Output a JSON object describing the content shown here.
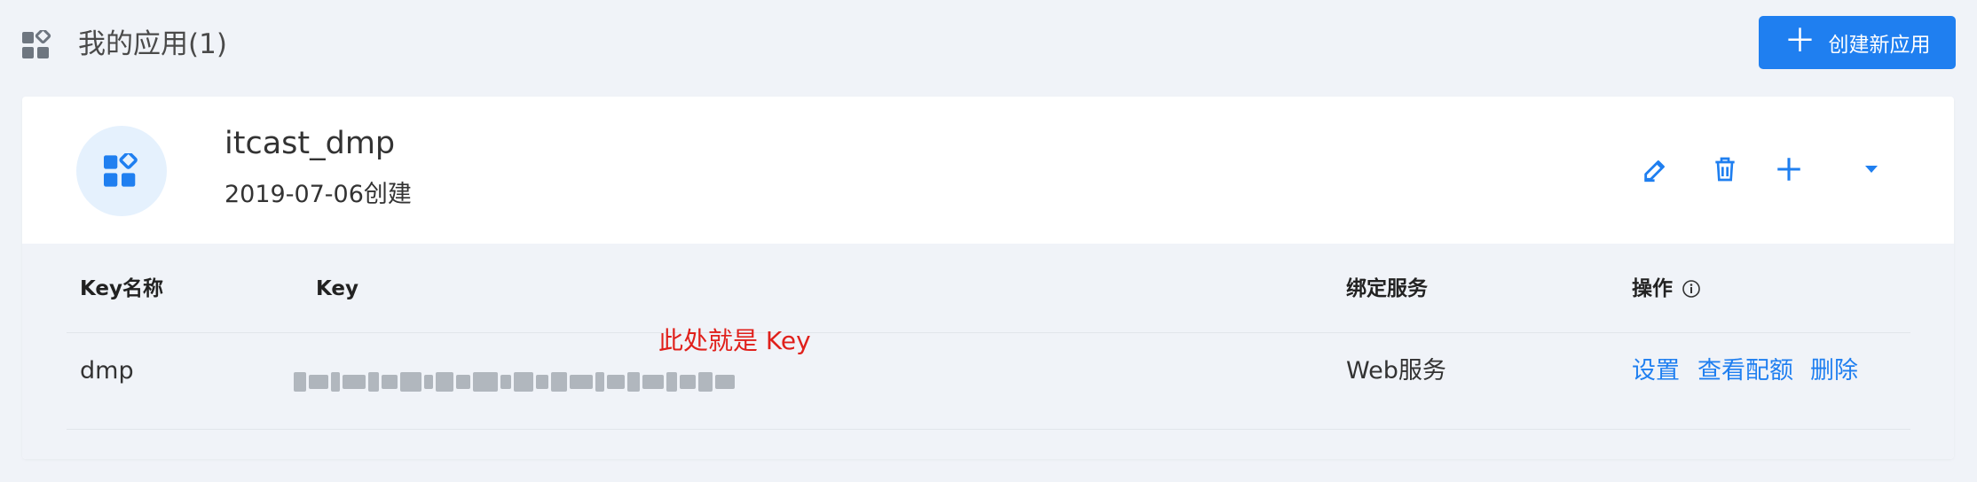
{
  "header": {
    "icon": "apps-grid-icon",
    "title": "我的应用(1)",
    "create_button_label": "创建新应用",
    "create_button_icon": "plus-icon"
  },
  "app": {
    "name": "itcast_dmp",
    "created": "2019-07-06创建",
    "avatar_icon": "apps-grid-icon",
    "actions": [
      "edit-icon",
      "trash-icon",
      "plus-icon",
      "caret-down-icon"
    ]
  },
  "table": {
    "headers": {
      "key_name": "Key名称",
      "key": "Key",
      "service": "绑定服务",
      "ops": "操作"
    },
    "rows": [
      {
        "key_name": "dmp",
        "key": "(blurred)",
        "service": "Web服务",
        "ops": [
          "设置",
          "查看配额",
          "删除"
        ]
      }
    ]
  },
  "annotation": "此处就是 Key",
  "colors": {
    "accent": "#1f7ff0",
    "annotation": "#e0201b",
    "background": "#f0f3f8"
  }
}
